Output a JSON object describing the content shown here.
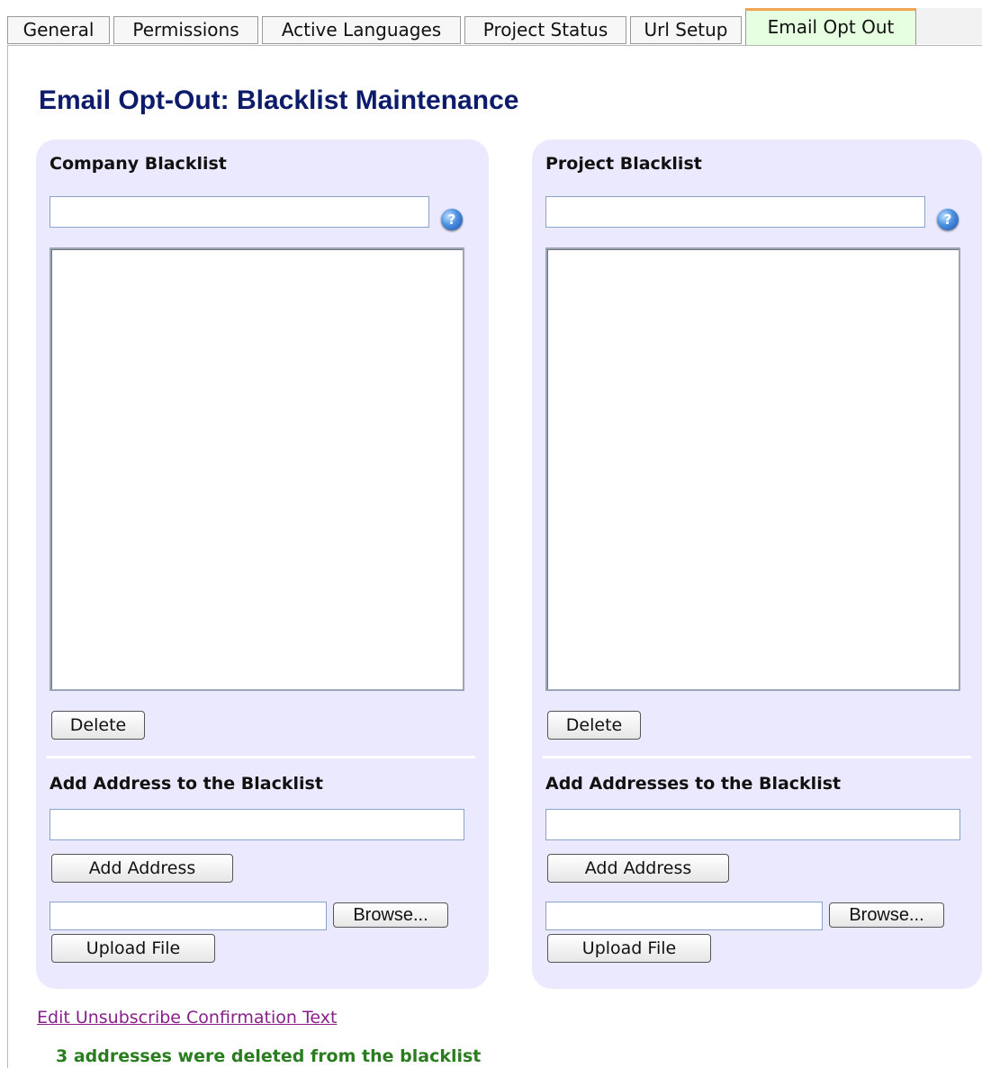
{
  "tabs": [
    {
      "label": "General"
    },
    {
      "label": "Permissions"
    },
    {
      "label": "Active Languages"
    },
    {
      "label": "Project Status"
    },
    {
      "label": "Url Setup"
    },
    {
      "label": "Email Opt Out",
      "active": true
    }
  ],
  "page_title": "Email Opt-Out: Blacklist Maintenance",
  "company": {
    "heading": "Company Blacklist",
    "search_value": "",
    "help_icon": "?",
    "delete_label": "Delete",
    "add_heading": "Add Address to the Blacklist",
    "add_value": "",
    "add_button": "Add Address",
    "file_value": "",
    "browse_label": "Browse...",
    "upload_label": "Upload File"
  },
  "project": {
    "heading": "Project Blacklist",
    "search_value": "",
    "help_icon": "?",
    "delete_label": "Delete",
    "add_heading": "Add Addresses to the Blacklist",
    "add_value": "",
    "add_button": "Add Address",
    "file_value": "",
    "browse_label": "Browse...",
    "upload_label": "Upload File"
  },
  "edit_link": "Edit Unsubscribe Confirmation Text",
  "status_message": "3 addresses were deleted from the blacklist",
  "colors": {
    "title": "#0d1b6b",
    "panel_bg": "#eae9fd",
    "active_tab_bg": "#e6ffe0",
    "active_tab_accent": "#f0a650",
    "link": "#8a1f8c",
    "status": "#2a7d1f"
  }
}
